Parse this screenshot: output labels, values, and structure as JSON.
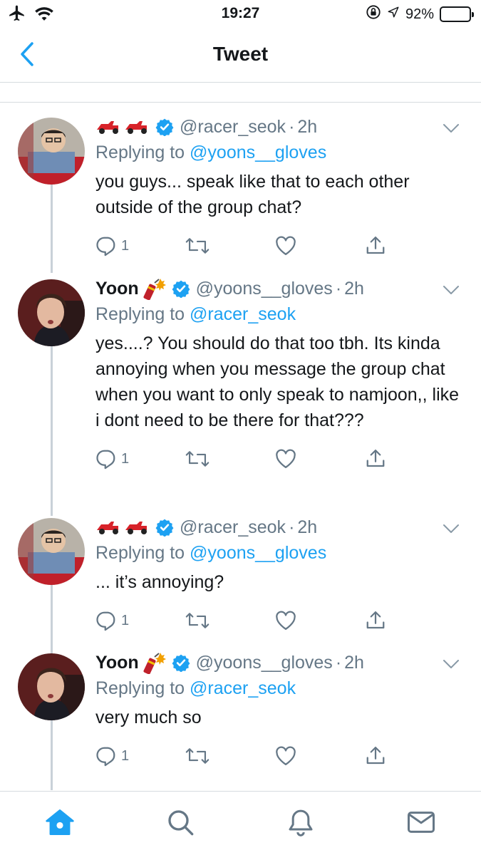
{
  "status_bar": {
    "time": "19:27",
    "battery": "92%",
    "battery_level": 0.92,
    "icons": [
      "airplane-icon",
      "wifi-icon",
      "rotation-lock-icon",
      "location-icon",
      "battery-icon"
    ]
  },
  "nav": {
    "title": "Tweet",
    "back_icon": "chevron-left-icon"
  },
  "tweets": [
    {
      "name": "",
      "name_emoji": "race-car-emoji",
      "handle": "@racer_seok",
      "time": "2h",
      "replying_prefix": "Replying to ",
      "replying_to": "@yoons__gloves",
      "text": "you guys... speak like that to each other outside of the group chat?",
      "reply_count": "1"
    },
    {
      "name": "Yoon",
      "name_emoji": "firecracker-emoji",
      "handle": "@yoons__gloves",
      "time": "2h",
      "replying_prefix": "Replying to ",
      "replying_to": "@racer_seok",
      "text": "yes....? You should do that too tbh. Its kinda annoying when you message the group chat when you want to only speak to namjoon,, like i dont need to be there for that???",
      "reply_count": "1"
    },
    {
      "name": "",
      "name_emoji": "race-car-emoji",
      "handle": "@racer_seok",
      "time": "2h",
      "replying_prefix": "Replying to ",
      "replying_to": "@yoons__gloves",
      "text": "... it’s annoying?",
      "reply_count": "1"
    },
    {
      "name": "Yoon",
      "name_emoji": "firecracker-emoji",
      "handle": "@yoons__gloves",
      "time": "2h",
      "replying_prefix": "Replying to ",
      "replying_to": "@racer_seok",
      "text": "very much so",
      "reply_count": "1"
    }
  ],
  "tabbar": {
    "tabs": [
      "home-icon",
      "search-icon",
      "notifications-icon",
      "messages-icon"
    ],
    "active": "home-icon"
  },
  "colors": {
    "accent": "#1da1f2",
    "muted": "#657786",
    "text": "#14171a",
    "divider": "#d6dbdf",
    "battery": "#f5c400"
  }
}
